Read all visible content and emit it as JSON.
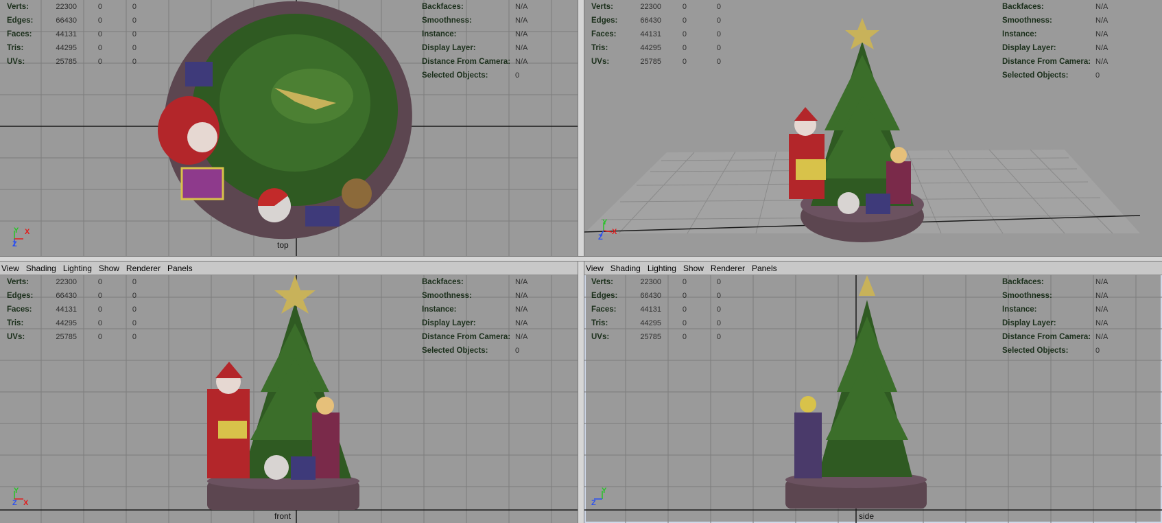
{
  "menus": [
    "View",
    "Shading",
    "Lighting",
    "Show",
    "Renderer",
    "Panels"
  ],
  "stats": {
    "rows": [
      {
        "label": "Verts:",
        "v1": "22300",
        "v2": "0",
        "v3": "0"
      },
      {
        "label": "Edges:",
        "v1": "66430",
        "v2": "0",
        "v3": "0"
      },
      {
        "label": "Faces:",
        "v1": "44131",
        "v2": "0",
        "v3": "0"
      },
      {
        "label": "Tris:",
        "v1": "44295",
        "v2": "0",
        "v3": "0"
      },
      {
        "label": "UVs:",
        "v1": "25785",
        "v2": "0",
        "v3": "0"
      }
    ],
    "right_rows": [
      {
        "label": "Backfaces:",
        "value": "N/A"
      },
      {
        "label": "Smoothness:",
        "value": "N/A"
      },
      {
        "label": "Instance:",
        "value": "N/A"
      },
      {
        "label": "Display Layer:",
        "value": "N/A"
      },
      {
        "label": "Distance From Camera:",
        "value": "N/A"
      },
      {
        "label": "Selected Objects:",
        "value": "0"
      }
    ]
  },
  "viewports": {
    "top": {
      "camera": "top"
    },
    "persp": {
      "camera": ""
    },
    "front": {
      "camera": "front"
    },
    "side": {
      "camera": "side"
    }
  },
  "axis_labels": {
    "x": "X",
    "y": "Y",
    "z": "Z"
  },
  "colors": {
    "viewport_bg": "#9a9a9a",
    "grid_line": "#7c7c7c",
    "grid_axis": "#1a1a1a",
    "hud_label": "#1b2f1b",
    "axis_x": "#e01c1c",
    "axis_y": "#26c426",
    "axis_z": "#2a4ff0"
  }
}
